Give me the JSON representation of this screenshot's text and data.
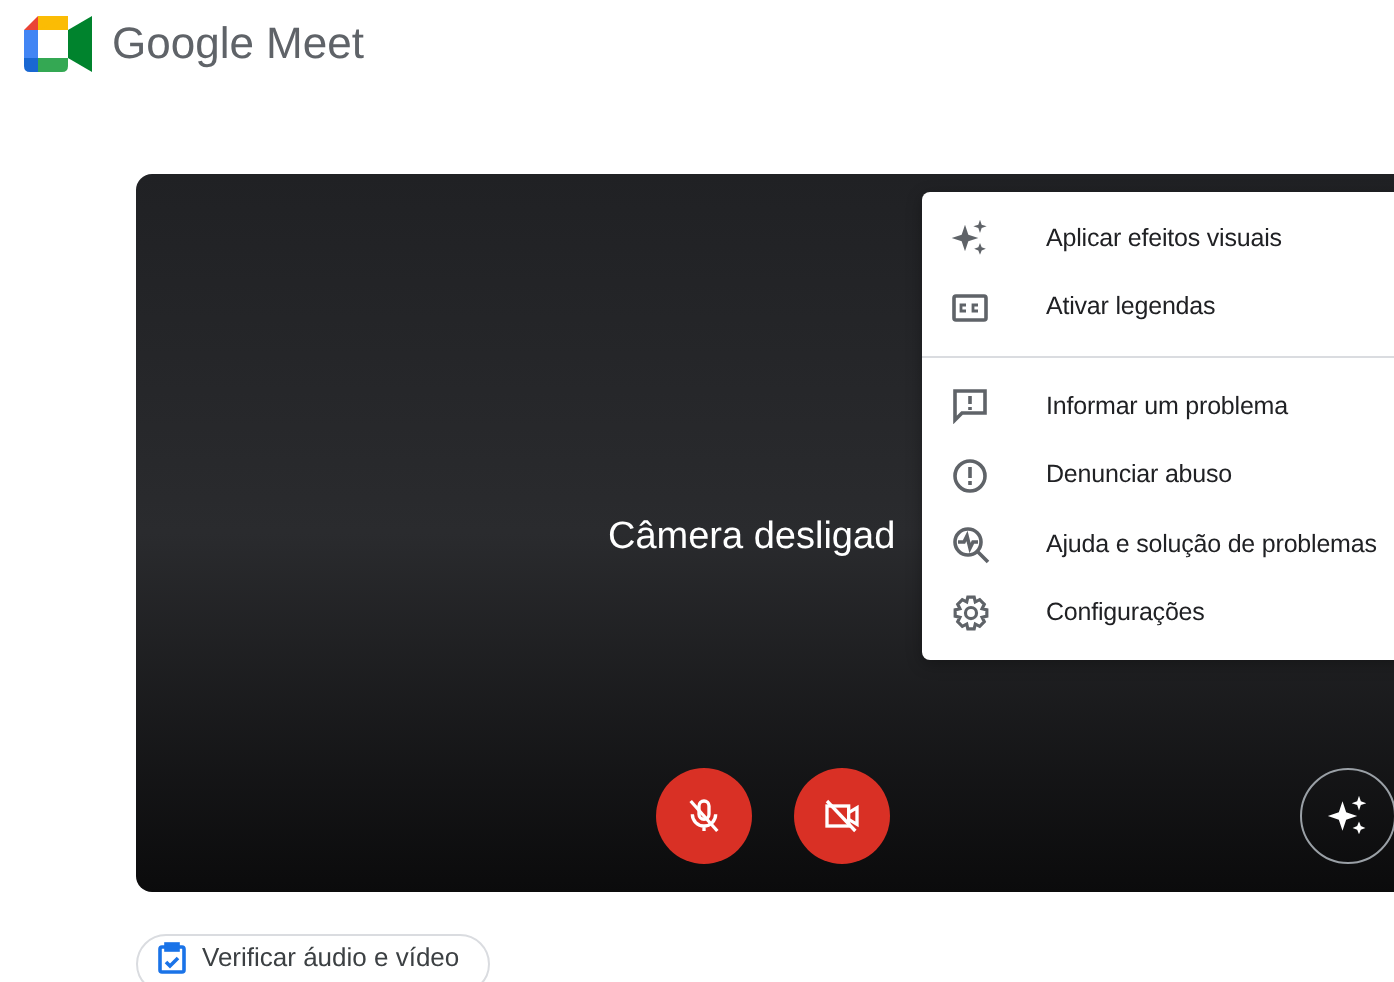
{
  "header": {
    "title": "Google Meet"
  },
  "preview": {
    "status": "Câmera desligad",
    "controls": [
      {
        "kind": "microphone",
        "on": false
      },
      {
        "kind": "camera",
        "on": false
      }
    ]
  },
  "menu": {
    "sections": [
      [
        {
          "label": "Aplicar efeitos visuais"
        },
        {
          "label": "Ativar legendas"
        }
      ],
      [
        {
          "label": "Informar um problema"
        },
        {
          "label": "Denunciar abuso"
        },
        {
          "label": "Ajuda e solução de problemas"
        },
        {
          "label": "Configurações"
        }
      ]
    ]
  },
  "check_button": {
    "label": "Verificar áudio e vídeo"
  }
}
